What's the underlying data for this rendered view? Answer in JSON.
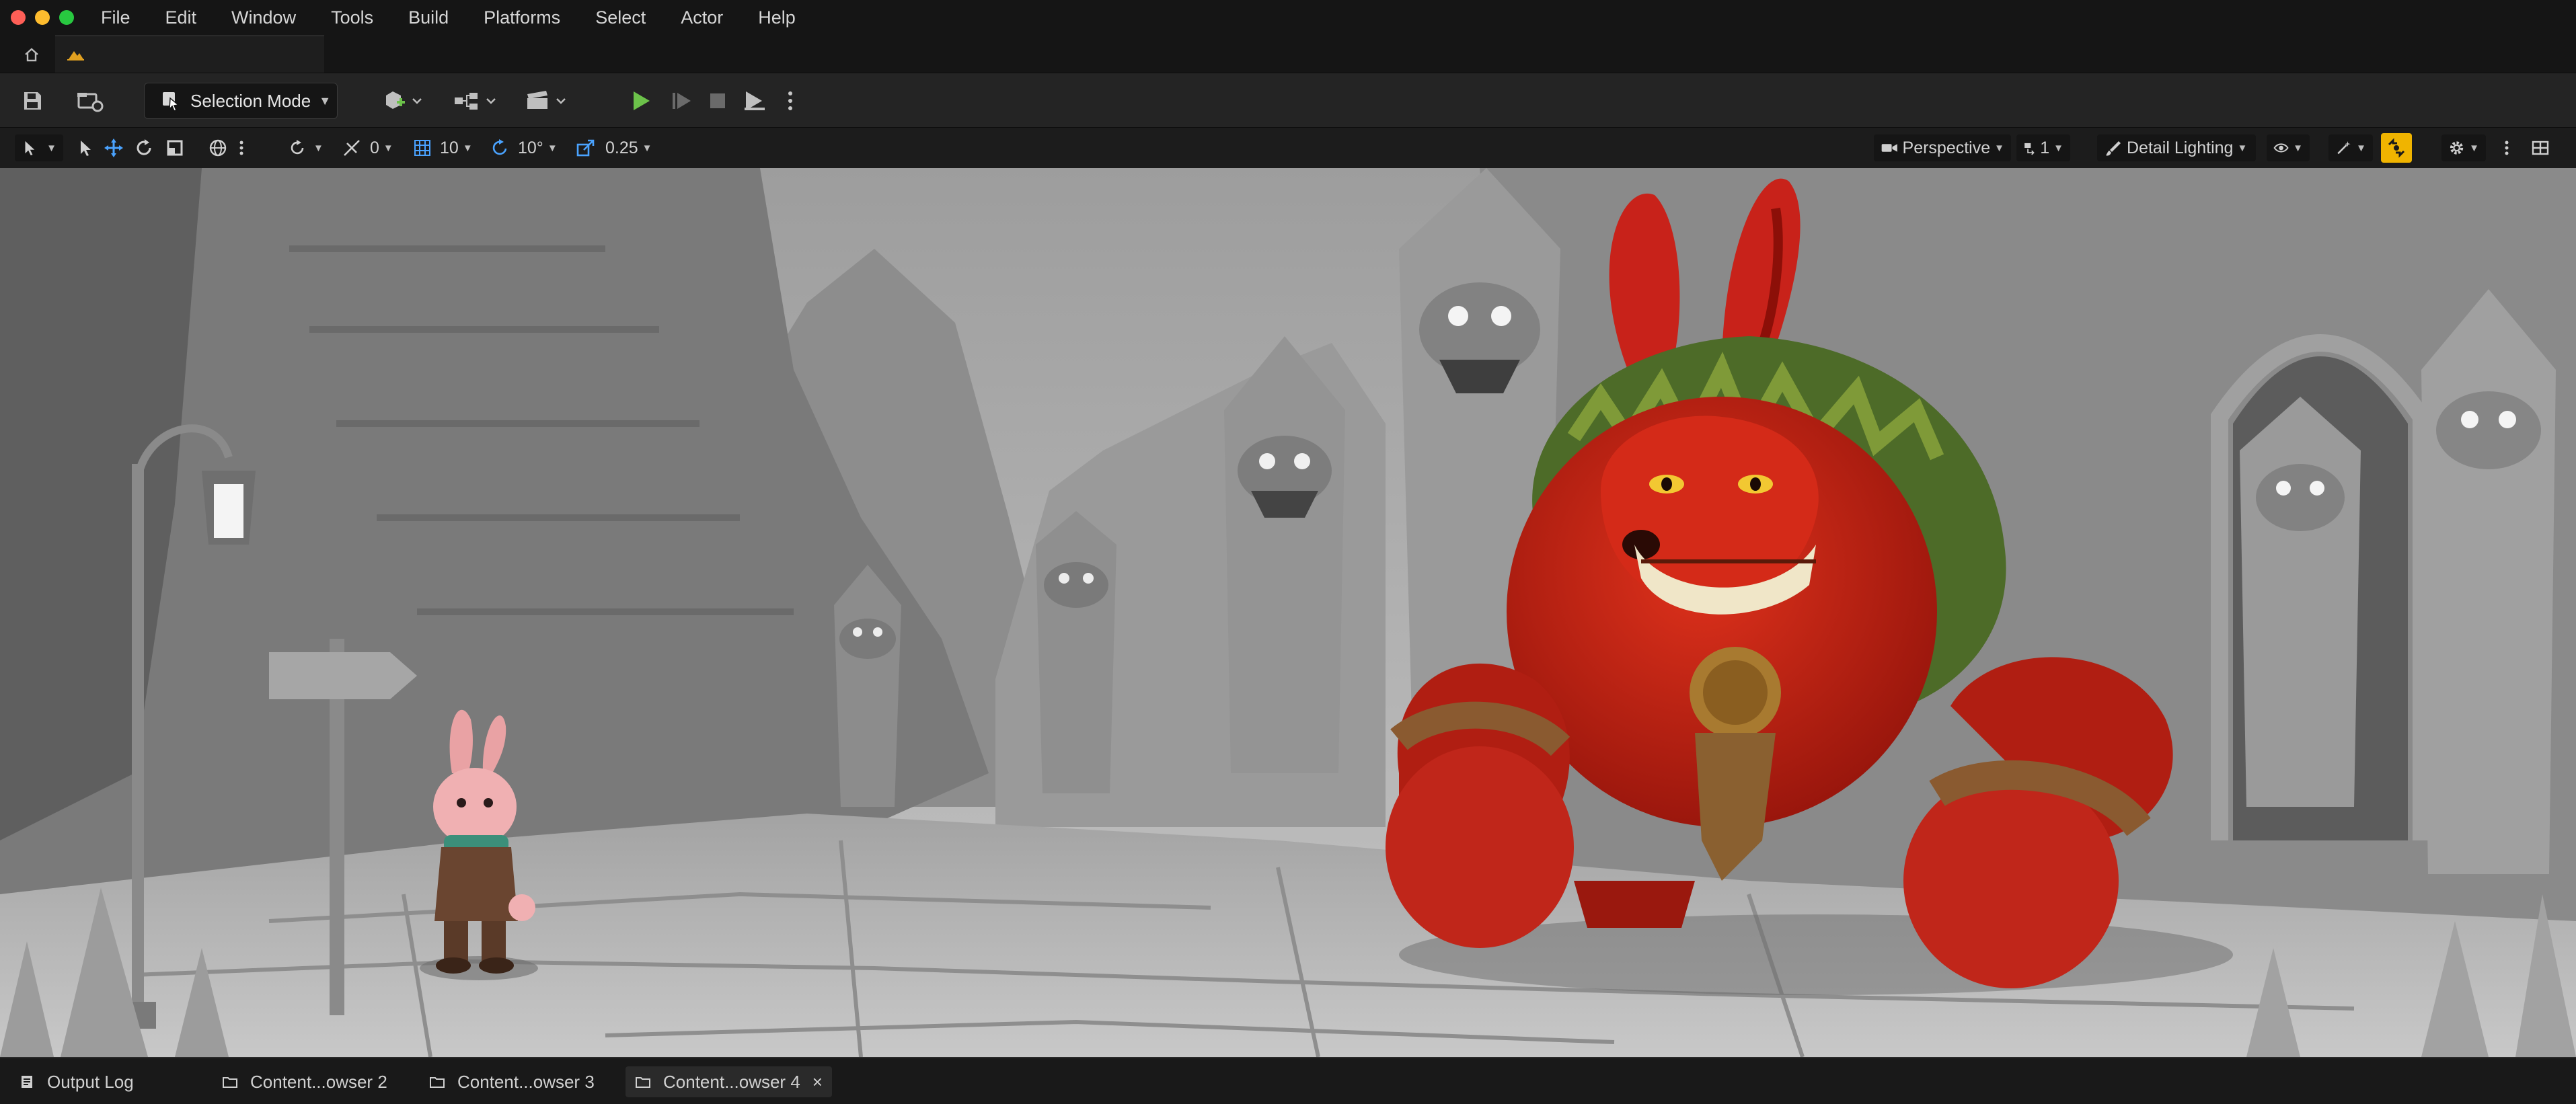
{
  "menubar": {
    "items": [
      "File",
      "Edit",
      "Window",
      "Tools",
      "Build",
      "Platforms",
      "Select",
      "Actor",
      "Help"
    ]
  },
  "toolbar": {
    "selection_mode_label": "Selection Mode"
  },
  "viewport_toolbar": {
    "grid_snap_rotation": "0",
    "grid_snap_location": "10",
    "rotation_snap": "10°",
    "scale_snap": "0.25",
    "view_mode": "Perspective",
    "camera_speed": "1",
    "lighting_mode": "Detail Lighting"
  },
  "bottom_tabs": [
    {
      "label": "Output Log"
    },
    {
      "label": "Content...owser 2"
    },
    {
      "label": "Content...owser 3"
    },
    {
      "label": "Content...owser 4",
      "close": "×"
    }
  ],
  "colors": {
    "play_green": "#6cc24a",
    "accent_yellow": "#f0b400",
    "close_red": "#ff5f57",
    "minimize_yellow": "#febc2e",
    "maximize_green": "#28c840"
  },
  "icons": [
    "home-icon",
    "level-icon",
    "save-icon",
    "source-control-icon",
    "add-actor-icon",
    "blueprint-icon",
    "cinematics-icon",
    "play-icon",
    "advance-frame-icon",
    "stop-icon",
    "launch-icon",
    "options-icon"
  ]
}
